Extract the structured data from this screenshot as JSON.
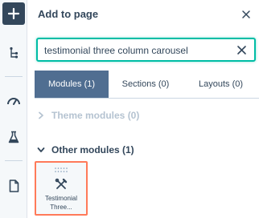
{
  "rail": {
    "items": [
      {
        "name": "add",
        "icon": "plus-icon"
      },
      {
        "name": "layers",
        "icon": "tree-structure-icon"
      },
      {
        "name": "optimize",
        "icon": "speedometer-icon"
      },
      {
        "name": "test",
        "icon": "flask-icon"
      },
      {
        "name": "page",
        "icon": "document-icon"
      }
    ]
  },
  "panel": {
    "title": "Add to page",
    "search": {
      "value": "testimonial three column carousel",
      "placeholder": "Search"
    },
    "tabs": [
      {
        "label": "Modules (1)",
        "active": true
      },
      {
        "label": "Sections (0)",
        "active": false
      },
      {
        "label": "Layouts (0)",
        "active": false
      }
    ],
    "groups": [
      {
        "label": "Theme modules (0)",
        "expanded": false
      },
      {
        "label": "Other modules (1)",
        "expanded": true
      }
    ],
    "module": {
      "line1": "Testimonial",
      "line2": "Three..."
    }
  },
  "colors": {
    "accent": "#00bda5",
    "active_tab": "#506e91",
    "selected_outline": "#ff7a59",
    "text": "#33475b",
    "muted": "#b5c3d1",
    "rail_bg": "#f5f8fa"
  }
}
